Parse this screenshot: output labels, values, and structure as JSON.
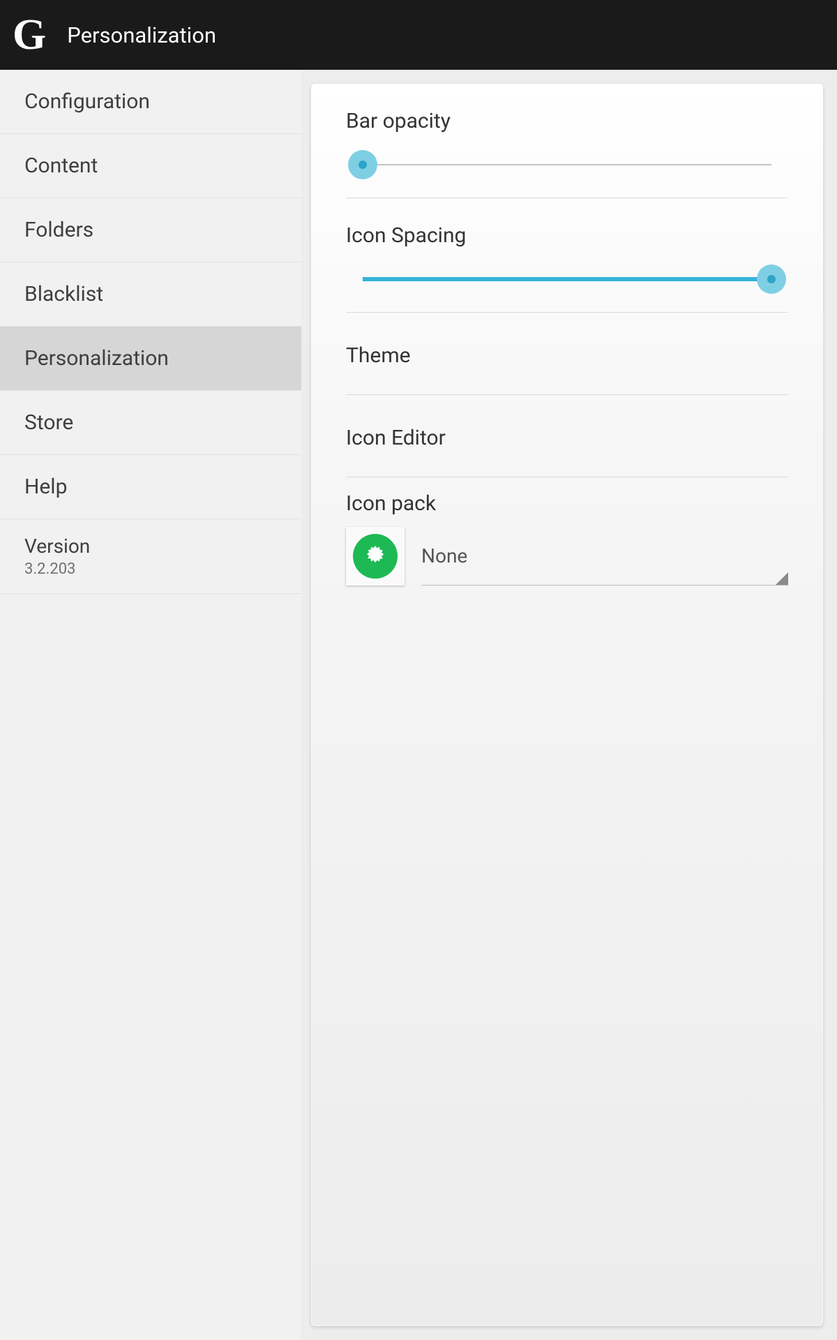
{
  "header": {
    "logo": "G",
    "title": "Personalization"
  },
  "sidebar": {
    "items": [
      {
        "label": "Configuration",
        "active": false
      },
      {
        "label": "Content",
        "active": false
      },
      {
        "label": "Folders",
        "active": false
      },
      {
        "label": "Blacklist",
        "active": false
      },
      {
        "label": "Personalization",
        "active": true
      },
      {
        "label": "Store",
        "active": false
      },
      {
        "label": "Help",
        "active": false
      }
    ],
    "version_label": "Version",
    "version_value": "3.2.203"
  },
  "settings": {
    "bar_opacity": {
      "label": "Bar opacity",
      "value_percent": 0
    },
    "icon_spacing": {
      "label": "Icon Spacing",
      "value_percent": 100
    },
    "theme_label": "Theme",
    "icon_editor_label": "Icon Editor",
    "icon_pack": {
      "label": "Icon pack",
      "selected": "None"
    }
  },
  "colors": {
    "accent": "#33b3da",
    "icon_green": "#1db954"
  }
}
